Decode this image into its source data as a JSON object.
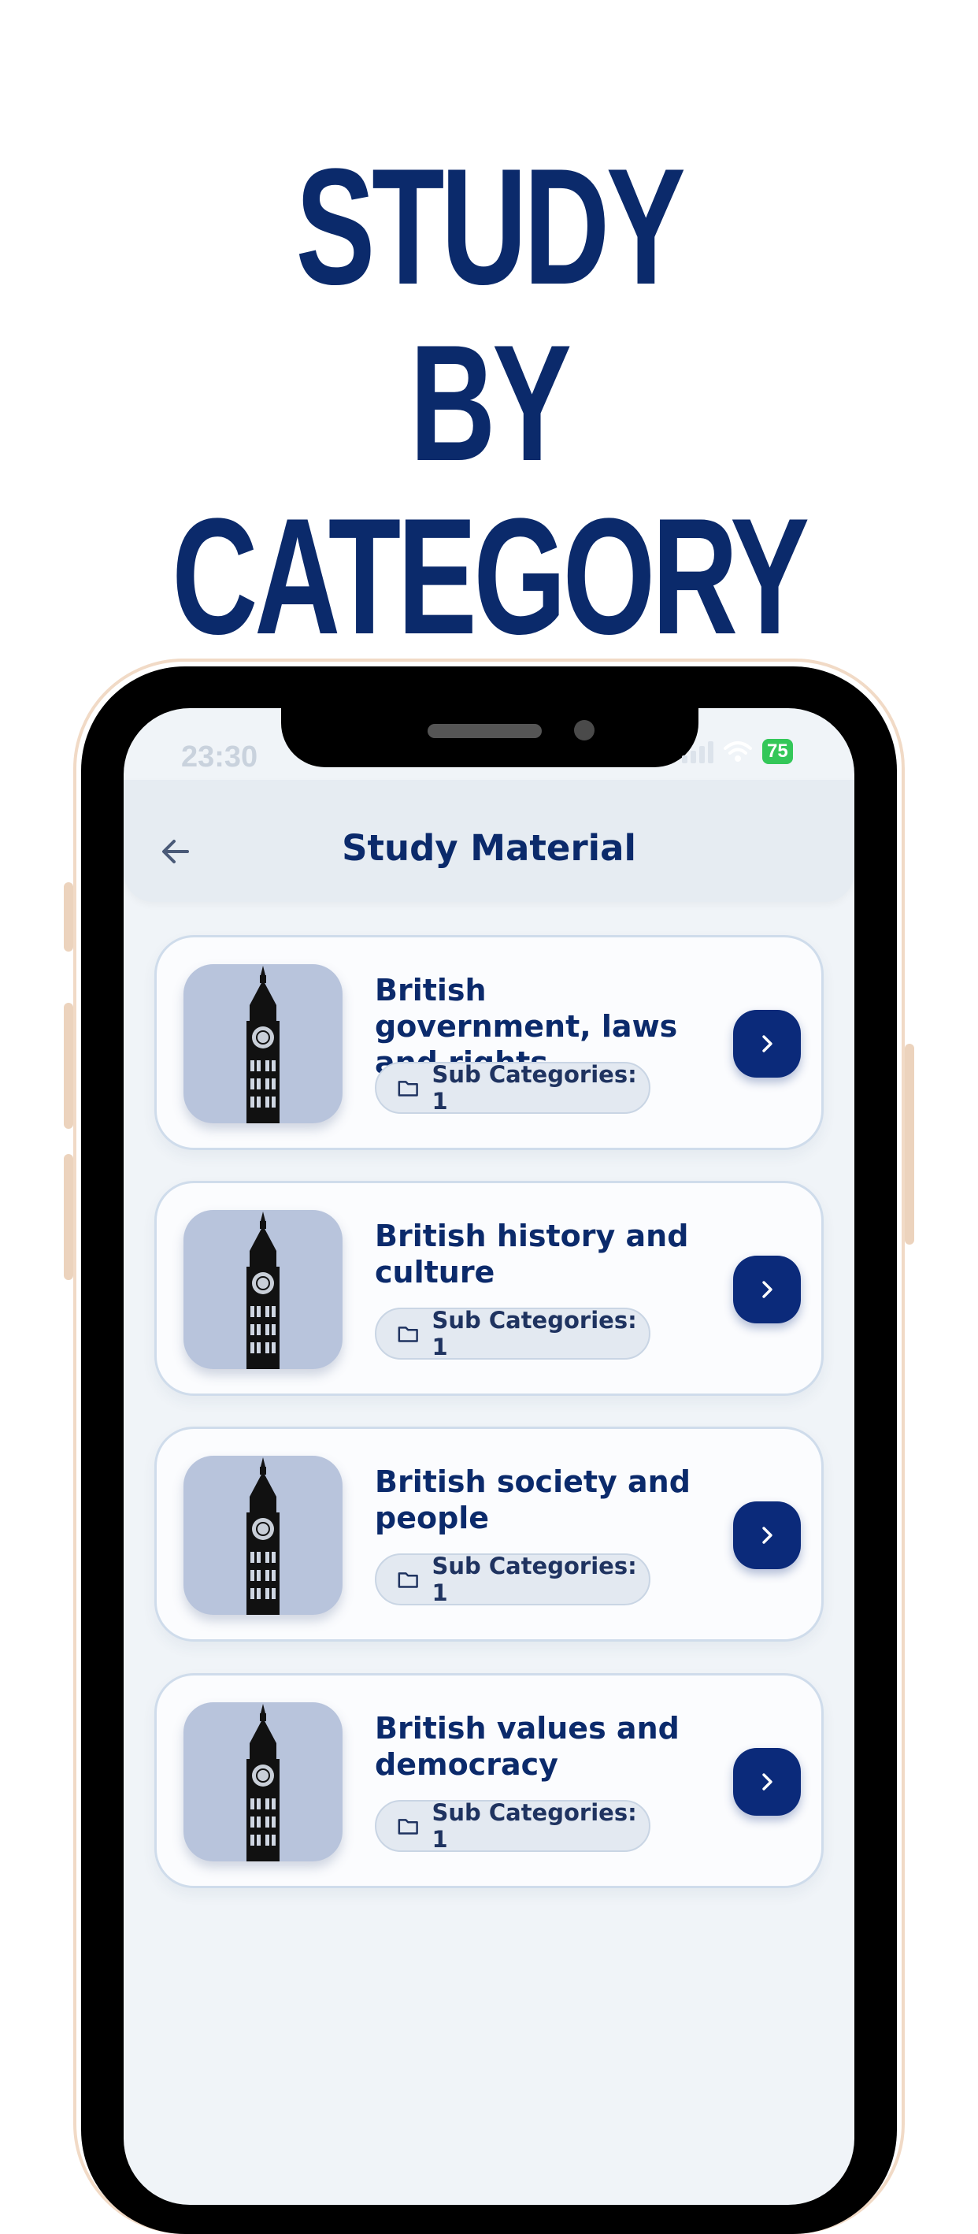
{
  "promo": {
    "line1": "STUDY",
    "line2": "BY CATEGORY"
  },
  "status_bar": {
    "time": "23:30",
    "battery": "75"
  },
  "header": {
    "title": "Study Material",
    "back_icon": "arrow-left-icon"
  },
  "categories": [
    {
      "title": "British government, laws and rights",
      "sub_label": "Sub Categories: 1",
      "icon": "big-ben-icon"
    },
    {
      "title": "British history and culture",
      "sub_label": "Sub Categories: 1",
      "icon": "big-ben-icon"
    },
    {
      "title": "British society and people",
      "sub_label": "Sub Categories: 1",
      "icon": "big-ben-icon"
    },
    {
      "title": "British values and democracy",
      "sub_label": "Sub Categories: 1",
      "icon": "big-ben-icon"
    }
  ],
  "colors": {
    "brand_navy": "#0b2a6b",
    "button_blue": "#0b2a7a",
    "thumb_bg": "#b8c4dc",
    "battery_green": "#34c759"
  }
}
